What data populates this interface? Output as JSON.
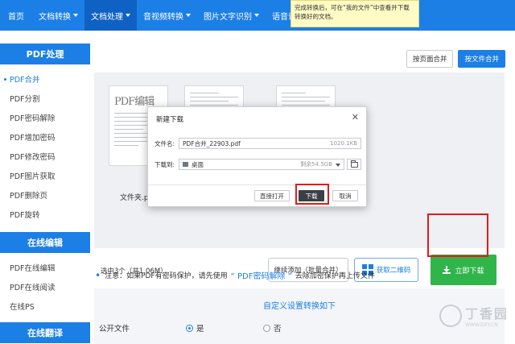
{
  "nav": {
    "home": "首页",
    "items": [
      {
        "label": "文档转换"
      },
      {
        "label": "文档处理"
      },
      {
        "label": "音视频转换"
      },
      {
        "label": "图片文字识别"
      },
      {
        "label": "语音识别"
      }
    ],
    "tooltip": "完成转换后，可在“我的文件”中查看并下载转换好的文档。"
  },
  "sidebar": {
    "section1": "PDF处理",
    "items1": [
      "PDF合并",
      "PDF分割",
      "PDF密码解除",
      "PDF增加密码",
      "PDF修改密码",
      "PDF图片获取",
      "PDF删除页",
      "PDF旋转"
    ],
    "section2": "在线编辑",
    "items2": [
      "PDF在线编辑",
      "PDF在线阅读",
      "在线PS"
    ],
    "section3": "在线翻译"
  },
  "main": {
    "mode_page": "按页面合并",
    "mode_file": "按文件合并",
    "thumb_title": "PDF编辑",
    "file_label": "文件夹.pdf",
    "selection_info": "选中3个（共1.06M）",
    "continue_add": "继续添加（批量合并）",
    "qr_button": "获取二维码",
    "download_now": "立即下载",
    "notice_prefix": "注意：如果PDF有密码保护，请先使用",
    "notice_link": "“ PDF密码解除 ”",
    "notice_suffix": "去除加密保护再上传文件",
    "settings_title": "自定义设置转换如下",
    "public_file_label": "公开文件",
    "option_yes": "是",
    "option_no": "否"
  },
  "dialog": {
    "title": "新建下载",
    "filename_label": "文件名:",
    "filename_value": "PDF合并_22903.pdf",
    "file_size": "1020.1KB",
    "saveto_label": "下载到:",
    "saveto_value": "桌面",
    "free_space": "剩余54.5GB",
    "open_button": "直接打开",
    "download_button": "下载",
    "cancel_button": "取消"
  },
  "watermark": {
    "brand": "丁香园",
    "url": "WWW.DXY.CN"
  },
  "colors": {
    "nav_blue": "#1c7fe6",
    "download_green": "#2fb54a",
    "highlight_red": "#e21b1b"
  }
}
